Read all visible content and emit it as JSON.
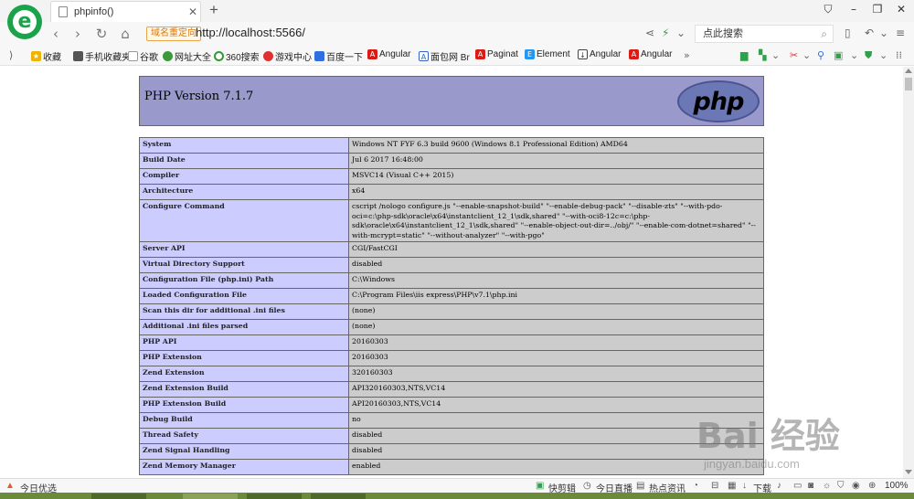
{
  "browser": {
    "tab_title": "phpinfo()",
    "tab_close": "✕",
    "new_tab": "+",
    "redirect_label": "域名重定向",
    "url": "http://localhost:5566/",
    "search_placeholder": "点此搜索"
  },
  "bookmarks": [
    {
      "label": "收藏",
      "icon": "star-icon",
      "color": "#f0b400"
    },
    {
      "label": "手机收藏夹",
      "icon": "phone-icon",
      "color": "#555555"
    },
    {
      "label": "谷歌",
      "icon": "page-icon",
      "color": "#777777"
    },
    {
      "label": "网址大全",
      "icon": "globe-icon",
      "color": "#3a9a3a"
    },
    {
      "label": "360搜索",
      "icon": "search-360-icon",
      "color": "#2e9b2e"
    },
    {
      "label": "游戏中心",
      "icon": "game-icon",
      "color": "#e03030"
    },
    {
      "label": "百度一下",
      "icon": "paw-icon",
      "color": "#2f6fe0"
    },
    {
      "label": "Angular",
      "icon": "angular-icon",
      "color": "#dd1b16"
    },
    {
      "label": "面包网 Br",
      "icon": "bread-icon",
      "color": "#3366cc"
    },
    {
      "label": "Paginat",
      "icon": "angular-icon",
      "color": "#dd1b16"
    },
    {
      "label": "Element",
      "icon": "element-icon",
      "color": "#2196f3"
    },
    {
      "label": "Angular",
      "icon": "download-icon",
      "color": "#444444"
    },
    {
      "label": "Angular",
      "icon": "angular-icon",
      "color": "#dd1b16"
    }
  ],
  "php": {
    "version_title": "PHP Version 7.1.7",
    "logo_text": "php",
    "rows": [
      {
        "key": "System",
        "value": "Windows NT FYF 6.3 build 9600 (Windows 8.1 Professional Edition) AMD64"
      },
      {
        "key": "Build Date",
        "value": "Jul 6 2017 16:48:00"
      },
      {
        "key": "Compiler",
        "value": "MSVC14 (Visual C++ 2015)"
      },
      {
        "key": "Architecture",
        "value": "x64"
      },
      {
        "key": "Configure Command",
        "value": "cscript /nologo configure.js \"--enable-snapshot-build\" \"--enable-debug-pack\" \"--disable-zts\" \"--with-pdo-oci=c:\\php-sdk\\oracle\\x64\\instantclient_12_1\\sdk,shared\" \"--with-oci8-12c=c:\\php-sdk\\oracle\\x64\\instantclient_12_1\\sdk,shared\" \"--enable-object-out-dir=../obj/\" \"--enable-com-dotnet=shared\" \"--with-mcrypt=static\" \"--without-analyzer\" \"--with-pgo\""
      },
      {
        "key": "Server API",
        "value": "CGI/FastCGI"
      },
      {
        "key": "Virtual Directory Support",
        "value": "disabled"
      },
      {
        "key": "Configuration File (php.ini) Path",
        "value": "C:\\Windows"
      },
      {
        "key": "Loaded Configuration File",
        "value": "C:\\Program Files\\iis express\\PHP\\v7.1\\php.ini"
      },
      {
        "key": "Scan this dir for additional .ini files",
        "value": "(none)"
      },
      {
        "key": "Additional .ini files parsed",
        "value": "(none)"
      },
      {
        "key": "PHP API",
        "value": "20160303"
      },
      {
        "key": "PHP Extension",
        "value": "20160303"
      },
      {
        "key": "Zend Extension",
        "value": "320160303"
      },
      {
        "key": "Zend Extension Build",
        "value": "API320160303,NTS,VC14"
      },
      {
        "key": "PHP Extension Build",
        "value": "API20160303,NTS,VC14"
      },
      {
        "key": "Debug Build",
        "value": "no"
      },
      {
        "key": "Thread Safety",
        "value": "disabled"
      },
      {
        "key": "Zend Signal Handling",
        "value": "disabled"
      },
      {
        "key": "Zend Memory Manager",
        "value": "enabled"
      }
    ]
  },
  "statusbar": {
    "left": "今日优选",
    "kuaijian": "快剪辑",
    "live": "今日直播",
    "hot": "热点资讯",
    "download": "下载",
    "zoom": "100%"
  },
  "watermark": {
    "brand": "Bai 经验",
    "site": "jingyan.baidu.com"
  }
}
